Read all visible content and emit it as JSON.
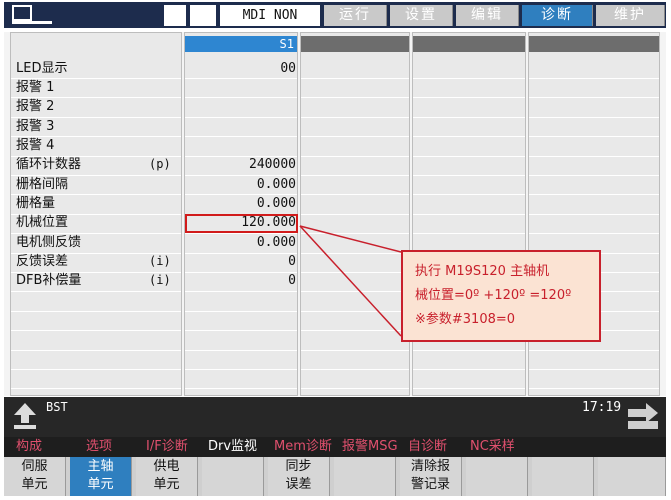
{
  "topbar": {
    "mode": "MDI NON",
    "tabs": [
      {
        "label": "运行",
        "active": false
      },
      {
        "label": "设置",
        "active": false
      },
      {
        "label": "编辑",
        "active": false
      },
      {
        "label": "诊断",
        "active": true
      },
      {
        "label": "维护",
        "active": false
      }
    ]
  },
  "grid": {
    "column_header": "S1",
    "rows": [
      {
        "label": "LED显示",
        "unit": "",
        "value": "00"
      },
      {
        "label": "报警 1",
        "unit": "",
        "value": ""
      },
      {
        "label": "报警 2",
        "unit": "",
        "value": ""
      },
      {
        "label": "报警 3",
        "unit": "",
        "value": ""
      },
      {
        "label": "报警 4",
        "unit": "",
        "value": ""
      },
      {
        "label": "循环计数器",
        "unit": "(p)",
        "value": "240000"
      },
      {
        "label": "栅格间隔",
        "unit": "",
        "value": "0.000"
      },
      {
        "label": "栅格量",
        "unit": "",
        "value": "0.000"
      },
      {
        "label": "机械位置",
        "unit": "",
        "value": "120.000"
      },
      {
        "label": "电机侧反馈",
        "unit": "",
        "value": "0.000"
      },
      {
        "label": "反馈误差",
        "unit": "(i)",
        "value": "0"
      },
      {
        "label": "DFB补偿量",
        "unit": "(i)",
        "value": "0"
      }
    ]
  },
  "callout": {
    "line1": "执行 M19S120 主轴机",
    "line2": "械位置=0º +120º =120º",
    "line3": "※参数#3108=0"
  },
  "status": {
    "label": "BST",
    "time": "17:19"
  },
  "menu": [
    {
      "label": "构成",
      "color": "#e0506e"
    },
    {
      "label": "选项",
      "color": "#e0506e"
    },
    {
      "label": "I/F诊断",
      "color": "#e0506e"
    },
    {
      "label": "Drv监视",
      "color": "#ffffff"
    },
    {
      "label": "Mem诊断",
      "color": "#e0506e"
    },
    {
      "label": "报警MSG",
      "color": "#e0506e"
    },
    {
      "label": "自诊断",
      "color": "#e0506e"
    },
    {
      "label": "NC采样",
      "color": "#e0506e"
    }
  ],
  "softkeys": [
    {
      "line1": "伺服",
      "line2": "单元",
      "active": false
    },
    {
      "line1": "主轴",
      "line2": "单元",
      "active": true
    },
    {
      "line1": "供电",
      "line2": "单元",
      "active": false
    },
    {
      "line1": "",
      "line2": "",
      "active": false
    },
    {
      "line1": "同步",
      "line2": "误差",
      "active": false
    },
    {
      "line1": "",
      "line2": "",
      "active": false
    },
    {
      "line1": "清除报",
      "line2": "警记录",
      "active": false
    },
    {
      "line1": "",
      "line2": "",
      "active": false
    },
    {
      "line1": "",
      "line2": "",
      "active": false
    },
    {
      "line1": "",
      "line2": "",
      "active": false
    }
  ]
}
